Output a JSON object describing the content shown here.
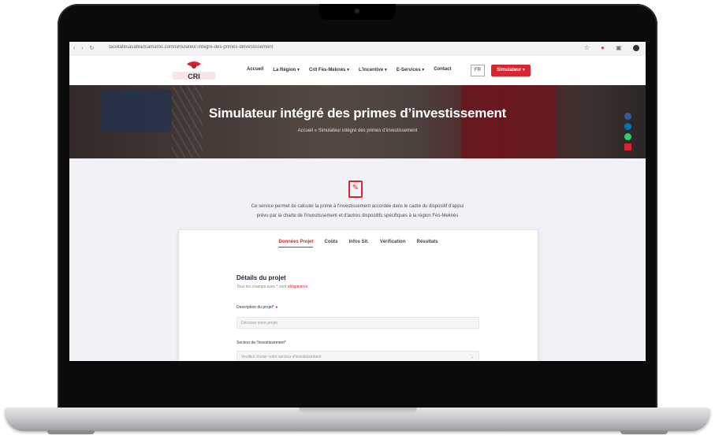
{
  "browser": {
    "url": "facilitatecasablancamaroc.com/simulateur-integre-des-primes-dinvestissement",
    "nav_glyphs": "‹ › ↻"
  },
  "site": {
    "logo_text": "CRI",
    "menu": [
      "Accueil",
      "La Région ▾",
      "Crit Fès-Meknès ▾",
      "L'Incentive ▾",
      "E-Services ▾",
      "Contact"
    ],
    "lang_label": "FR",
    "cta_label": "Simulateur ▾"
  },
  "hero": {
    "title": "Simulateur intégré des primes d’investissement",
    "breadcrumb": "Accueil  »  Simulateur intégré des primes d’investissement"
  },
  "social": {
    "items": [
      "facebook-icon",
      "linkedin-icon",
      "whatsapp-icon",
      "mail-icon"
    ],
    "colors": [
      "#3b5998",
      "#0077b5",
      "#25d366",
      "#d7262f"
    ]
  },
  "content": {
    "intro_line1": "Ce service permet de calculer la prime à l'investissement accordée dans le cadre du dispositif d'appui",
    "intro_line2": "prévu par la charte de l'investissement et d'autres dispositifs spécifiques à la région Fès-Meknès",
    "tabs": [
      "Données Projet",
      "Coûts",
      "Infos Sit.",
      "Vérification",
      "Résultats"
    ],
    "active_tab": 0,
    "section_title": "Détails du projet",
    "section_sub": "Tous les champs avec * sont",
    "section_sub_link": "obligatoires",
    "field1_label": "Description du projet*",
    "field1_placeholder": "Décrivez votre projet",
    "field2_label": "Secteur de l'investissement*",
    "field2_placeholder": "Veuillez choisir votre secteur d'investissement"
  },
  "colors": {
    "accent": "#d7262f",
    "frame": "#0b0b0c",
    "page_bg": "#f1f2f6"
  }
}
